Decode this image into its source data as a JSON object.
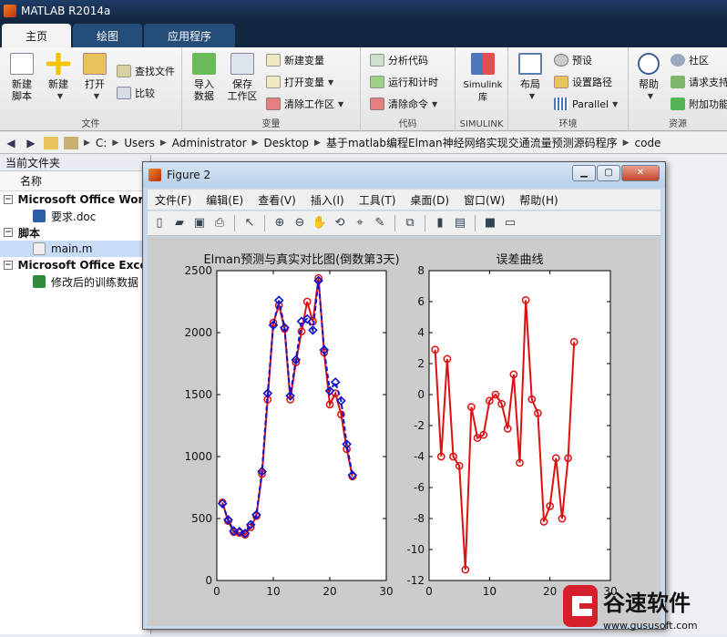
{
  "app": {
    "title": "MATLAB R2014a"
  },
  "tabs": [
    "主页",
    "绘图",
    "应用程序"
  ],
  "ribbon": {
    "file": {
      "label": "文件",
      "new_script": "新建\n脚本",
      "new": "新建",
      "open": "打开",
      "find_files": "查找文件",
      "compare": "比较"
    },
    "variable": {
      "label": "变量",
      "import": "导入\n数据",
      "save_workspace": "保存\n工作区",
      "new_var": "新建变量",
      "open_var": "打开变量",
      "clear_ws": "清除工作区"
    },
    "code": {
      "label": "代码",
      "analyze": "分析代码",
      "run_time": "运行和计时",
      "clear_cmd": "清除命令"
    },
    "simulink": {
      "label": "SIMULINK",
      "lib": "Simulink\n库"
    },
    "env": {
      "label": "环境",
      "layout": "布局",
      "prefs": "预设",
      "path": "设置路径",
      "parallel": "Parallel"
    },
    "resources": {
      "label": "资源",
      "help": "帮助",
      "community": "社区",
      "support": "请求支持",
      "addons": "附加功能"
    }
  },
  "address": {
    "crumbs": [
      "C:",
      "Users",
      "Administrator",
      "Desktop",
      "基于matlab编程Elman神经网络实现交通流量预测源码程序",
      "code"
    ]
  },
  "left_panel": {
    "title": "当前文件夹",
    "column": "名称",
    "groups": [
      {
        "name": "Microsoft Office Word",
        "files": [
          "要求.doc"
        ]
      },
      {
        "name": "脚本",
        "files": [
          "main.m"
        ]
      },
      {
        "name": "Microsoft Office Excel",
        "files": [
          "修改后的训练数据"
        ]
      }
    ]
  },
  "figure": {
    "title": "Figure 2",
    "menu": [
      "文件(F)",
      "编辑(E)",
      "查看(V)",
      "插入(I)",
      "工具(T)",
      "桌面(D)",
      "窗口(W)",
      "帮助(H)"
    ],
    "window_buttons": {
      "min": "▁",
      "max": "▢",
      "close": "✕"
    }
  },
  "chart_data": [
    {
      "type": "line",
      "title": "Elman预测与真实对比图(倒数第3天)",
      "xlim": [
        0,
        30
      ],
      "ylim": [
        0,
        2500
      ],
      "xticks": [
        0,
        10,
        20,
        30
      ],
      "yticks": [
        0,
        500,
        1000,
        1500,
        2000,
        2500
      ],
      "x": [
        1,
        2,
        3,
        4,
        5,
        6,
        7,
        8,
        9,
        10,
        11,
        12,
        13,
        14,
        15,
        16,
        17,
        18,
        19,
        20,
        21,
        22,
        23,
        24
      ],
      "series": [
        {
          "values": [
            630,
            480,
            390,
            385,
            370,
            430,
            520,
            860,
            1460,
            2080,
            2220,
            2030,
            1460,
            1760,
            2010,
            2250,
            2090,
            2440,
            1840,
            1420,
            1510,
            1340,
            1060,
            840
          ],
          "color": "#dd1111",
          "marker": "o",
          "style": "solid"
        },
        {
          "values": [
            620,
            490,
            400,
            395,
            380,
            450,
            530,
            880,
            1510,
            2060,
            2260,
            2040,
            1490,
            1780,
            2090,
            2110,
            2020,
            2420,
            1860,
            1530,
            1600,
            1450,
            1100,
            850
          ],
          "color": "#1111cc",
          "marker": "diamond",
          "style": "dashed"
        }
      ]
    },
    {
      "type": "line",
      "title": "误差曲线",
      "xlim": [
        0,
        30
      ],
      "ylim": [
        -12,
        8
      ],
      "xticks": [
        0,
        10,
        20,
        30
      ],
      "yticks": [
        -12,
        -10,
        -8,
        -6,
        -4,
        -2,
        0,
        2,
        4,
        6,
        8
      ],
      "x": [
        1,
        2,
        3,
        4,
        5,
        6,
        7,
        8,
        9,
        10,
        11,
        12,
        13,
        14,
        15,
        16,
        17,
        18,
        19,
        20,
        21,
        22,
        23,
        24
      ],
      "series": [
        {
          "values": [
            2.9,
            -4.0,
            2.3,
            -4.0,
            -4.6,
            -11.3,
            -0.8,
            -2.8,
            -2.6,
            -0.4,
            0.0,
            -0.6,
            -2.2,
            1.3,
            -4.4,
            6.1,
            -0.3,
            -1.2,
            -8.2,
            -7.2,
            -4.1,
            -8.0,
            -4.1,
            3.4
          ],
          "color": "#dd1111",
          "marker": "o",
          "style": "solid"
        }
      ]
    }
  ],
  "watermark": {
    "brand": "谷速软件",
    "url": "www.gususoft.com"
  }
}
